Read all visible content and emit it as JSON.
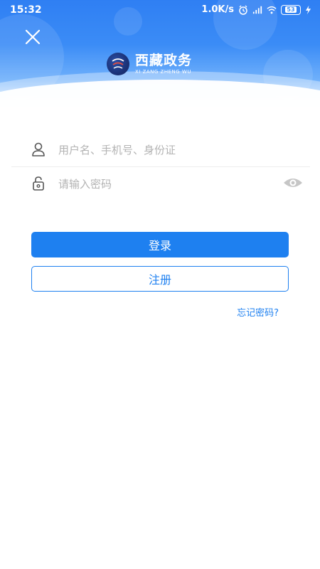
{
  "status_bar": {
    "time": "15:32",
    "network_speed": "1.0K/s",
    "battery_level": "53",
    "icons": [
      "alarm-icon",
      "signal-icon",
      "wifi-icon",
      "battery-icon",
      "charging-icon"
    ]
  },
  "header": {
    "close_icon": "close-icon",
    "logo_title": "西藏政务",
    "logo_subtitle": "XI ZANG ZHENG WU",
    "colors": {
      "gradient_top": "#2f7ff3",
      "gradient_bottom": "#cfe5fe"
    }
  },
  "form": {
    "username_placeholder": "用户名、手机号、身份证",
    "password_placeholder": "请输入密码",
    "username_icon": "user-icon",
    "password_icon": "lock-icon",
    "visibility_icon": "eye-icon"
  },
  "actions": {
    "login_label": "登录",
    "register_label": "注册",
    "forgot_label": "忘记密码?",
    "accent_color": "#1e80f0"
  }
}
